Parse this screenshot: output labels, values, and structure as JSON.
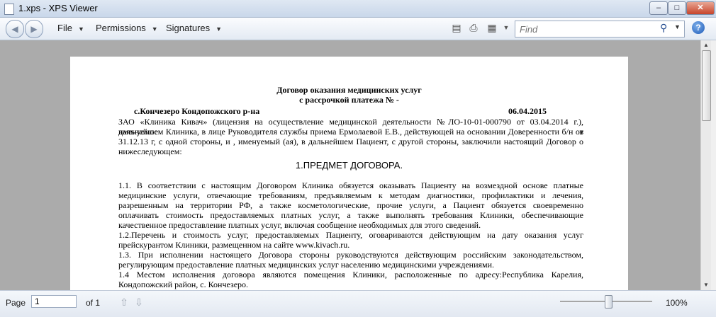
{
  "window": {
    "title": "1.xps - XPS Viewer"
  },
  "toolbar": {
    "menus": [
      "File",
      "Permissions",
      "Signatures"
    ],
    "search_placeholder": "Find",
    "help_label": "?"
  },
  "document": {
    "title_line1": "Договор оказания медицинских услуг",
    "title_line2": "с рассрочкой платежа №  -",
    "place": "с.Кончезеро Кондопожского р-на",
    "date": "06.04.2015",
    "intro": [
      "ЗАО «Клиника Кивач» (лицензия на осуществление медицинской деятельности №ЛО-10-01-000790 от 03.04.2014 г.), именуемое в",
      "дальнейшем Клиника, в лице Руководителя службы приема Ермолаевой Е.В., действующей на основании Доверенности б/н от",
      "31.12.13 г, с одной стороны, и , именуемый (ая), в дальнейшем Пациент, с другой стороны, заключили настоящий Договор о",
      "нижеследующем:"
    ],
    "section_title": "1.ПРЕДМЕТ ДОГОВОРА.",
    "clauses": [
      "1.1. В соответствии с настоящим Договором Клиника обязуется оказывать Пациенту на возмездной основе платные",
      " медицинские услуги, отвечающие требованиям, предъявляемым к методам диагностики, профилактики и лечения,",
      " разрешенным на территории РФ, а также косметологические, прочие услуги, а Пациент обязуется своевременно",
      "оплачивать стоимость  предоставляемых платных услуг, а также выполнять требования Клиники, обеспечивающие",
      " качественное предоставление платных услуг, включая сообщение необходимых для этого сведений.",
      "1.2.Перечень и стоимость услуг, предоставляемых Пациенту, оговариваются действующим на дату оказания услуг",
      "прейскурантом  Клиники, размещенном на сайте www.kivach.ru.",
      "1.3. При исполнении настоящего Договора стороны руководствуются действующим российским законодательством,",
      "регулирующим предоставление платных медицинских услуг населению медицинскими учреждениями.",
      "1.4 Местом исполнения договора являются помещения Клиники, расположенные по адресу:Республика Карелия,",
      "Кондопожский район, с. Кончезеро."
    ]
  },
  "statusbar": {
    "page_label": "Page",
    "page_value": "1",
    "of_label": "of 1",
    "zoom": "100%"
  }
}
